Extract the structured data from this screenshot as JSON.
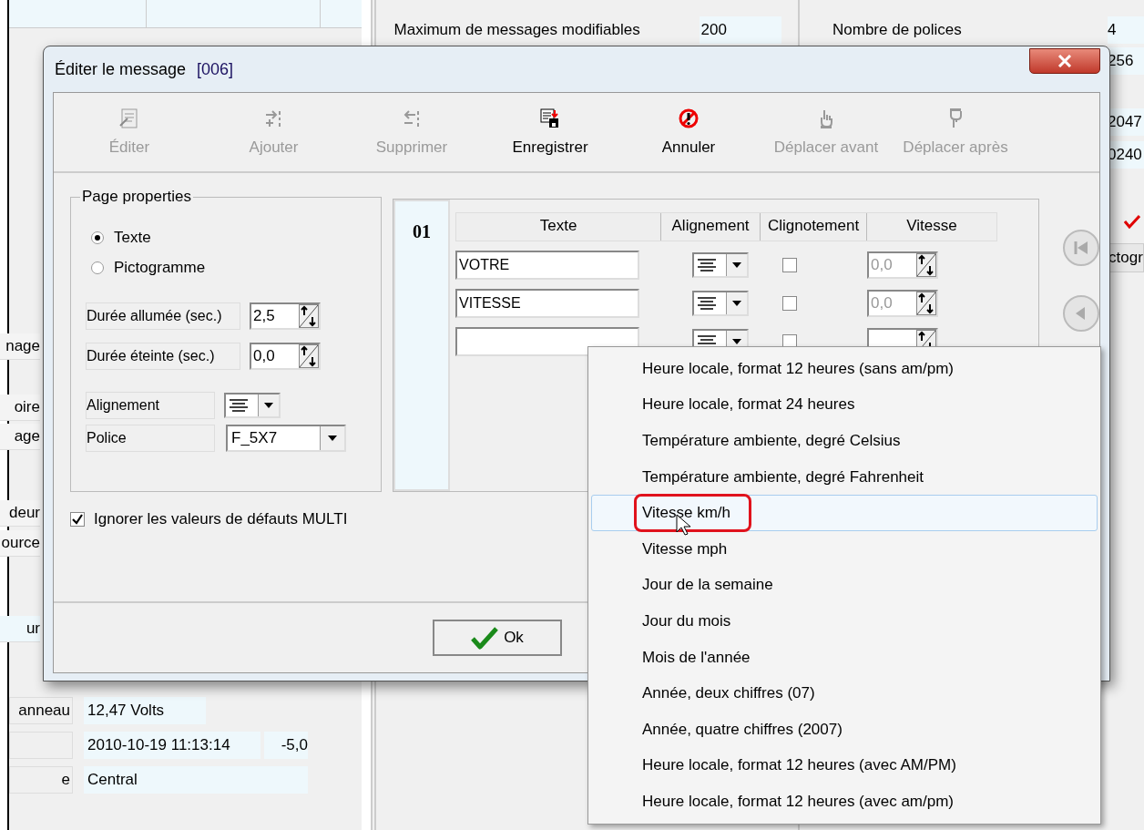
{
  "background": {
    "left_labels": [
      {
        "text": "nage"
      },
      {
        "text": "oire"
      },
      {
        "text": "age"
      },
      {
        "text": "deur"
      },
      {
        "text": "ource"
      },
      {
        "text": "ur"
      }
    ],
    "left_rows": [
      {
        "label": "anneau",
        "value": "12,47 Volts"
      },
      {
        "value": "2010-10-19 11:13:14",
        "extra": "-5,0"
      },
      {
        "label": "e",
        "value": "Central"
      }
    ],
    "middle_rows": [
      {
        "label": "Maximum de messages modifiables",
        "value": "200"
      }
    ],
    "right_rows": [
      {
        "label": "Nombre de polices",
        "value": "4"
      },
      {
        "value": "256"
      },
      {
        "value": "2047"
      },
      {
        "value": "0240"
      }
    ],
    "right_tab": "ctogr"
  },
  "dialog": {
    "title": "Éditer le message",
    "code": "[006]",
    "toolbar": [
      {
        "kind": "edit",
        "label": "Éditer",
        "disabled": true
      },
      {
        "kind": "add",
        "label": "Ajouter",
        "disabled": true
      },
      {
        "kind": "remove",
        "label": "Supprimer",
        "disabled": true
      },
      {
        "kind": "save",
        "label": "Enregistrer",
        "disabled": false
      },
      {
        "kind": "cancel",
        "label": "Annuler",
        "disabled": false
      },
      {
        "kind": "up",
        "label": "Déplacer avant",
        "disabled": true
      },
      {
        "kind": "down",
        "label": "Déplacer après",
        "disabled": true
      }
    ],
    "page_properties": {
      "title": "Page properties",
      "types": [
        {
          "label": "Texte",
          "selected": true
        },
        {
          "label": "Pictogramme",
          "selected": false
        }
      ],
      "durations": [
        {
          "label": "Durée allumée (sec.)",
          "value": "2,5"
        },
        {
          "label": "Durée éteinte (sec.)",
          "value": "0,0"
        }
      ],
      "alignment_label": "Alignement",
      "font_label": "Police",
      "font_value": "F_5X7"
    },
    "ignore_defaults": {
      "label": "Ignorer les valeurs de défauts MULTI",
      "checked": true
    },
    "page_number": "01",
    "columns": [
      "Texte",
      "Alignement",
      "Clignotement",
      "Vitesse"
    ],
    "lines": [
      {
        "text": "VOTRE",
        "blink": false,
        "speed": "0,0"
      },
      {
        "text": "VITESSE",
        "blink": false,
        "speed": "0,0"
      },
      {
        "blink": false
      }
    ],
    "ok_label": "Ok"
  },
  "menu": [
    {
      "label": "Heure locale, format 12 heures (sans am/pm)",
      "selected": false,
      "annotated": false
    },
    {
      "label": "Heure locale, format 24 heures",
      "selected": false,
      "annotated": false
    },
    {
      "label": "Température ambiente, degré Celsius",
      "selected": false,
      "annotated": false
    },
    {
      "label": "Température ambiente, degré Fahrenheit",
      "selected": false,
      "annotated": false
    },
    {
      "label": "Vitesse km/h",
      "selected": true,
      "annotated": true
    },
    {
      "label": "Vitesse mph",
      "selected": false,
      "annotated": false
    },
    {
      "label": "Jour de la semaine",
      "selected": false,
      "annotated": false
    },
    {
      "label": "Jour du mois",
      "selected": false,
      "annotated": false
    },
    {
      "label": "Mois de l'année",
      "selected": false,
      "annotated": false
    },
    {
      "label": "Année, deux chiffres (07)",
      "selected": false,
      "annotated": false
    },
    {
      "label": "Année, quatre chiffres (2007)",
      "selected": false,
      "annotated": false
    },
    {
      "label": "Heure locale, format 12 heures (avec AM/PM)",
      "selected": false,
      "annotated": false
    },
    {
      "label": "Heure locale, format 12 heures (avec am/pm)",
      "selected": false,
      "annotated": false
    }
  ]
}
